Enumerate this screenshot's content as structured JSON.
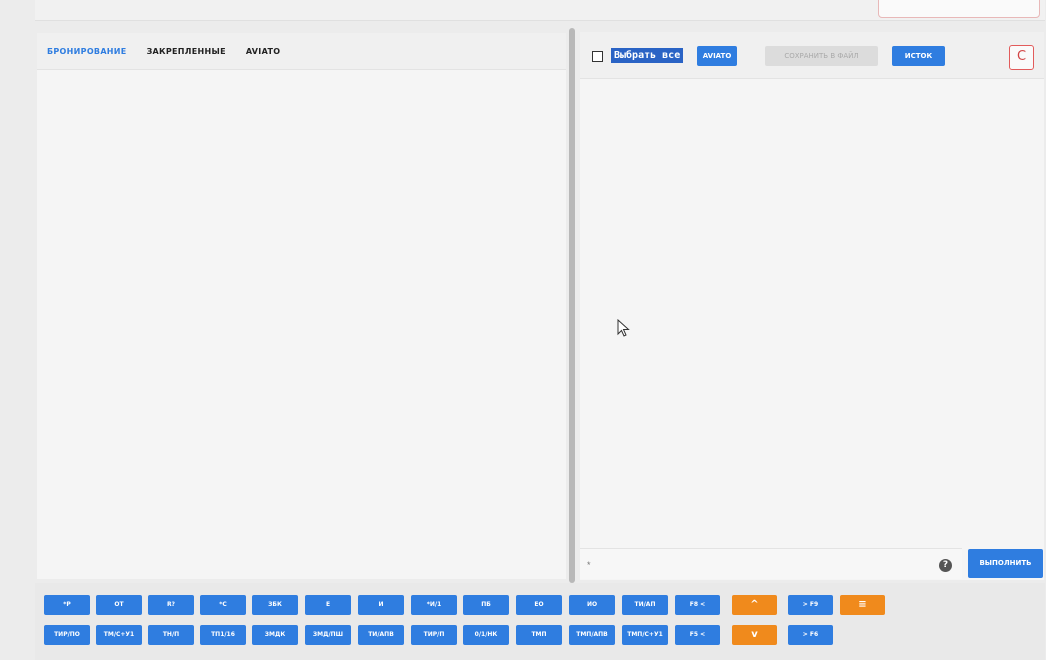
{
  "left_tabs": [
    "БРОНИРОВАНИЕ",
    "ЗАКРЕПЛЕННЫЕ",
    "AVIATO"
  ],
  "toolbar": {
    "select_all": "Выбрать все",
    "aviato": "AVIATO",
    "save_to_file": "СОХРАНИТЬ В ФАЙЛ",
    "source": "ИСТОК",
    "refresh_icon": "C"
  },
  "command": {
    "placeholder": "*",
    "help": "?",
    "run": "ВЫПОЛНИТЬ"
  },
  "keyboard": {
    "row1": [
      "*P",
      "OT",
      "R?",
      "*C",
      "ЗБК",
      "E",
      "И",
      "*И/1",
      "ПБ",
      "EO",
      "ИО",
      "ТИ/АП",
      "F8 <",
      "^",
      "> F9",
      "≡"
    ],
    "row2": [
      "ТИР/ПО",
      "ТМ/С+У1",
      "ТН/П",
      "ТП1/16",
      "ЗМДК",
      "ЗМД/ПШ",
      "ТИ/АПВ",
      "ТИР/П",
      "0/1/НК",
      "ТМП",
      "ТМП/АПВ",
      "ТМП/С+У1",
      "F5 <",
      "v",
      "> F6"
    ]
  },
  "colors": {
    "primary": "#2f7de0",
    "orange": "#f08a1c",
    "select_highlight": "#2a63c5",
    "refresh_red": "#e25b5b"
  }
}
